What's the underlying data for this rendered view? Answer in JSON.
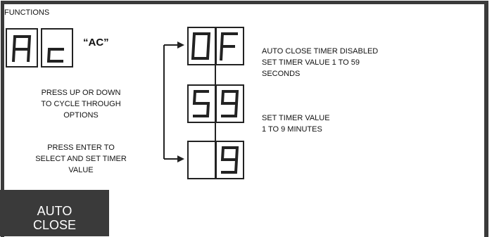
{
  "heading": "FUNCTIONS",
  "ac_label": "“AC”",
  "instructions": {
    "cycle": [
      "PRESS UP OR DOWN",
      "TO CYCLE THROUGH",
      "OPTIONS"
    ],
    "select": [
      "PRESS ENTER TO",
      "SELECT AND SET TIMER",
      "VALUE"
    ]
  },
  "options": [
    {
      "display": "0F",
      "desc": [
        "AUTO CLOSE TIMER DISABLED",
        "SET TIMER VALUE 1 TO 59",
        "SECONDS"
      ]
    },
    {
      "display": "59",
      "desc": [
        "SET TIMER VALUE",
        "1 TO 9 MINUTES"
      ]
    },
    {
      "display": " 9",
      "desc": []
    }
  ],
  "function_display": "Ac",
  "tab": {
    "line1": "AUTO",
    "line2": "CLOSE"
  },
  "colors": {
    "frame": "#3a3a3a",
    "tab_bg": "#3a3a3a",
    "tab_text": "#ffffff"
  }
}
